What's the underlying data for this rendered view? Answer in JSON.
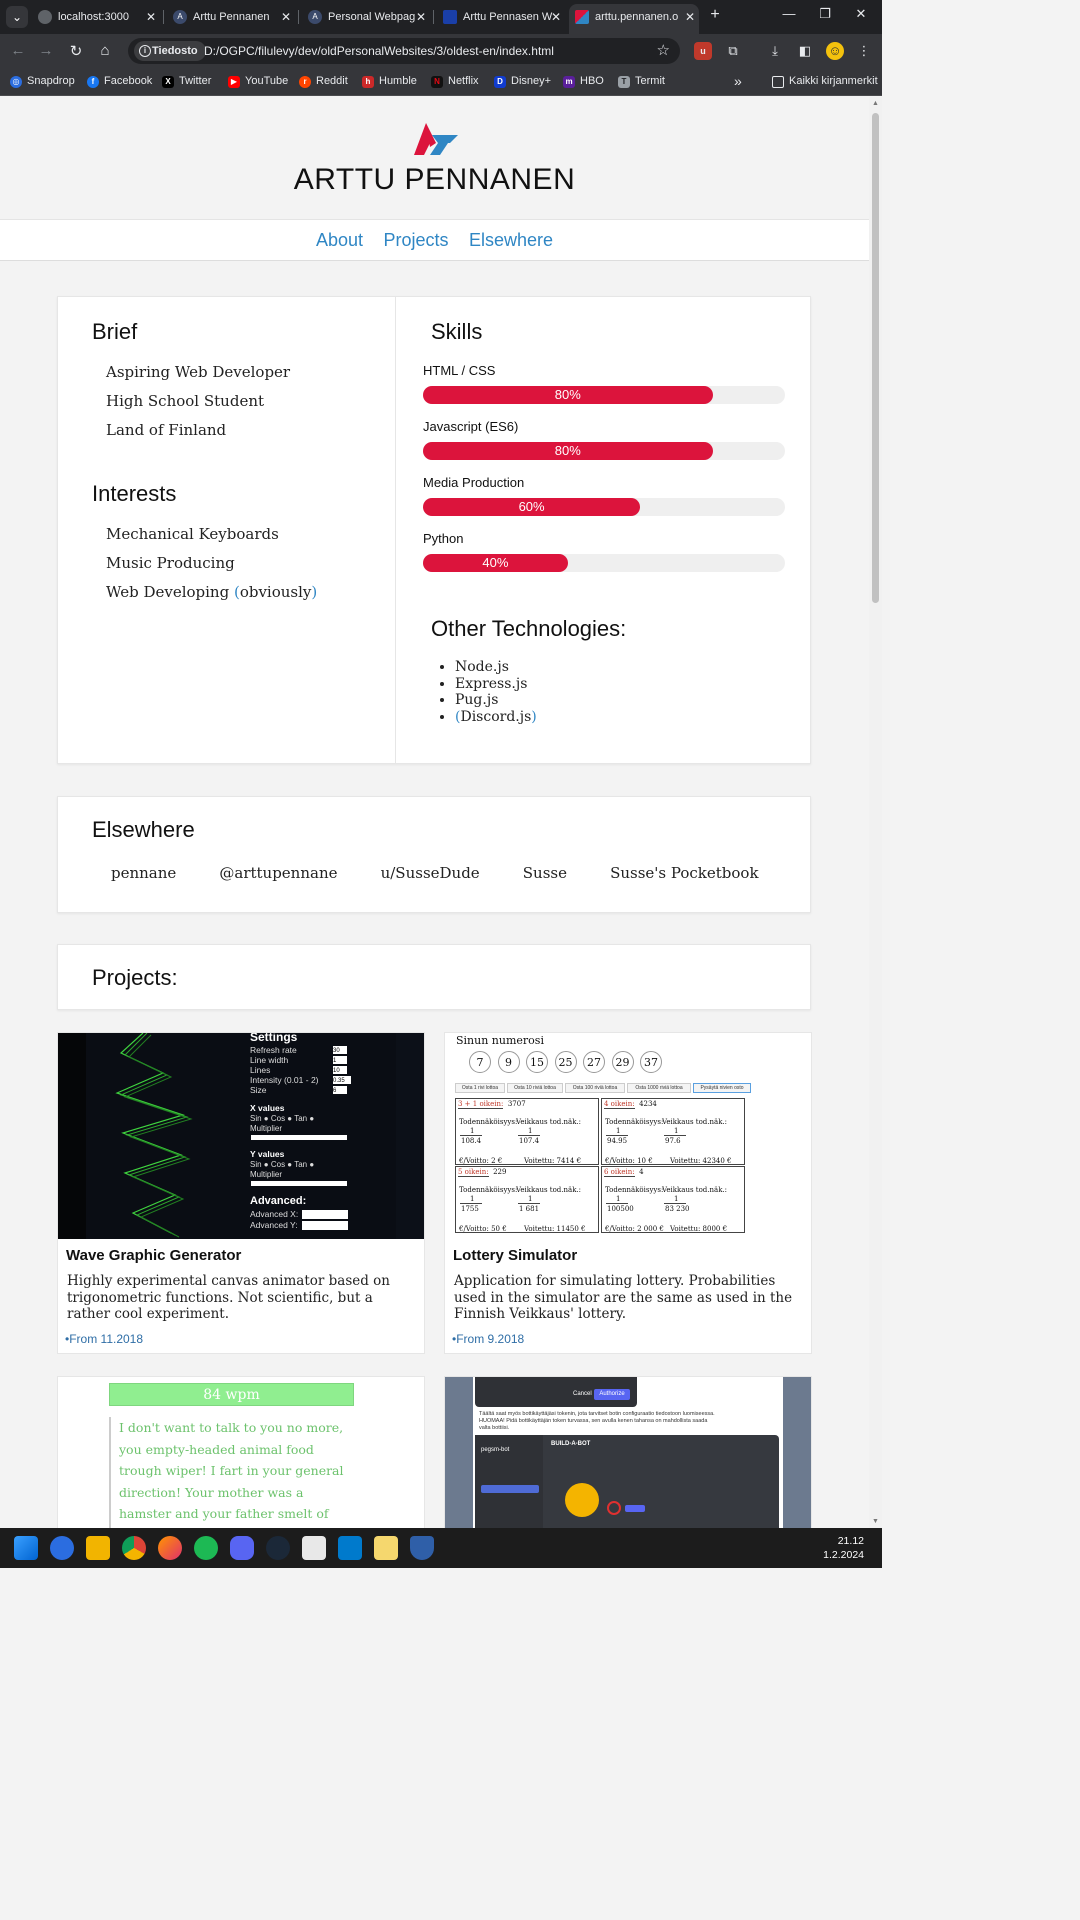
{
  "browser": {
    "tabs": [
      {
        "label": "localhost:3000",
        "active": false
      },
      {
        "label": "Arttu Pennanen",
        "active": false
      },
      {
        "label": "Personal Webpag",
        "active": false
      },
      {
        "label": "Arttu Pennasen W",
        "active": false
      },
      {
        "label": "arttu.pennanen.o",
        "active": true
      }
    ],
    "address": {
      "chip": "Tiedosto",
      "url": "D:/OGPC/filulevy/dev/oldPersonalWebsites/3/oldest-en/index.html"
    },
    "bookmarks": [
      "Snapdrop",
      "Facebook",
      "Twitter",
      "YouTube",
      "Reddit",
      "Humble",
      "Netflix",
      "Disney+",
      "HBO",
      "Termit"
    ],
    "bookmarks_more": "»",
    "all_bookmarks": "Kaikki kirjanmerkit"
  },
  "site": {
    "title": "ARTTU PENNANEN",
    "nav": [
      "About",
      "Projects",
      "Elsewhere"
    ]
  },
  "about": {
    "brief_heading": "Brief",
    "brief_items": [
      "Aspiring Web Developer",
      "High School Student",
      "Land of Finland"
    ],
    "interests_heading": "Interests",
    "interests_items": [
      "Mechanical Keyboards",
      "Music Producing",
      "Web Developing"
    ],
    "interests_last_suffix": "obviously",
    "skills_heading": "Skills",
    "skills": [
      {
        "name": "HTML / CSS",
        "percent_label": "80%",
        "level": 0.8
      },
      {
        "name": "Javascript (ES6)",
        "percent_label": "80%",
        "level": 0.8
      },
      {
        "name": "Media Production",
        "percent_label": "60%",
        "level": 0.6
      },
      {
        "name": "Python",
        "percent_label": "40%",
        "level": 0.4
      }
    ],
    "other_heading": "Other Technologies:",
    "other_items": [
      "Node.js",
      "Express.js",
      "Pug.js",
      "Discord.js"
    ]
  },
  "elsewhere": {
    "heading": "Elsewhere",
    "links": [
      "pennane",
      "@arttupennane",
      "u/SusseDude",
      "Susse",
      "Susse's Pocketbook"
    ]
  },
  "projects": {
    "heading": "Projects:",
    "items": [
      {
        "title": "Wave Graphic Generator",
        "description": "Highly experimental canvas animator based on trigonometric functions. Not scientific, but a rather cool experiment.",
        "date": "•From 11.2018",
        "shot": {
          "settings_title": "Settings",
          "settings_rows": [
            "Refresh rate",
            "Line width",
            "Lines",
            "Intensity (0.01 - 2)",
            "Size"
          ],
          "settings_values": [
            "30",
            "1",
            "10",
            "0.35",
            "6"
          ],
          "x_heading": "X values",
          "x_funcs": "Sin ● Cos ● Tan ●",
          "multiplier": "Multiplier",
          "y_heading": "Y values",
          "y_funcs": "Sin ● Cos ● Tan ●",
          "advanced": "Advanced:",
          "advanced_x": "Advanced X:",
          "advanced_y": "Advanced Y:"
        }
      },
      {
        "title": "Lottery Simulator",
        "description": "Application for simulating lottery. Probabilities used in the simulator are the same as used in the Finnish Veikkaus' lottery.",
        "date": "•From 9.2018",
        "shot": {
          "numbers_heading": "Sinun numerosi",
          "numbers": [
            "7",
            "9",
            "15",
            "25",
            "27",
            "29",
            "37"
          ],
          "buttons": [
            "Osta 1 rivi lottoa",
            "Osta 10 riviä lottoa",
            "Osta 100 riviä lottoa",
            "Osta 1000 riviä lottoa",
            "Pysäytä nivien osto"
          ],
          "boxes": [
            {
              "head": "3 + 1 oikein:",
              "count": "3707",
              "odds": "108.4",
              "vodds": "107.4",
              "stake": "2",
              "won": "7414"
            },
            {
              "head": "4 oikein:",
              "count": "4234",
              "odds": "94.95",
              "vodds": "97.6",
              "stake": "10",
              "won": "42340"
            },
            {
              "head": "5 oikein:",
              "count": "229",
              "odds": "1755",
              "vodds": "1 681",
              "stake": "50",
              "won": "11450"
            },
            {
              "head": "6 oikein:",
              "count": "4",
              "odds": "100500",
              "vodds": "83 230",
              "stake": "2 000",
              "won": "8000"
            }
          ],
          "label_odds": "Todennäköisyys:",
          "label_vodds": "Veikkaus tod.näk.:",
          "label_stake": "€/Voitto:",
          "label_won": "Voitettu:",
          "one": "1",
          "euro": "€"
        }
      },
      {
        "shot": {
          "wpm": "84 wpm",
          "text": "I don't want to talk to you no more, you empty-headed animal food trough wiper! I fart in your general direction! Your mother was a hamster and your father smelt of elderberries!"
        }
      },
      {
        "shot": {
          "cancel": "Cancel",
          "authorize": "Authorize",
          "note": "Täältä saat myös bottikäyttäjäsi tokenin, jota tarvitset botin configuraatio tiedostoon luomiseessa. HUOMAA! Pidä bottikäyttäjän token turvassa, sen avulla kenen tahansa on mahdollista saada valta bottiisi.",
          "app_name": "pegsm-bot",
          "section": "BUILD-A-BOT"
        }
      }
    ]
  },
  "taskbar": {
    "time": "21.12",
    "date": "1.2.2024"
  },
  "colors": {
    "accent": "#dc143c",
    "link": "#2f86c4",
    "chrome_dark": "#202124"
  }
}
